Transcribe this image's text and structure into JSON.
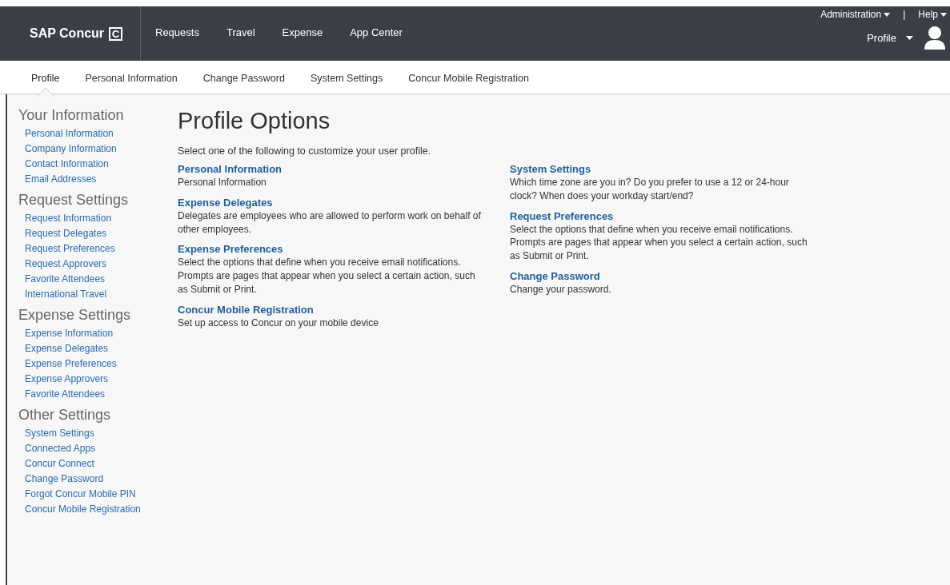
{
  "header": {
    "logo": "SAP Concur",
    "logo_mark": "C",
    "nav": [
      {
        "label": "Requests"
      },
      {
        "label": "Travel"
      },
      {
        "label": "Expense"
      },
      {
        "label": "App Center"
      }
    ],
    "top_links": [
      {
        "label": "Administration"
      },
      {
        "label": "Help"
      }
    ],
    "separator": "|",
    "profile_menu": "Profile"
  },
  "tabs": [
    {
      "label": "Profile",
      "selected": true
    },
    {
      "label": "Personal Information",
      "selected": false
    },
    {
      "label": "Change Password",
      "selected": false
    },
    {
      "label": "System Settings",
      "selected": false
    },
    {
      "label": "Concur Mobile Registration",
      "selected": false
    }
  ],
  "sidebar": [
    {
      "title": "Your Information",
      "items": [
        "Personal Information",
        "Company Information",
        "Contact Information",
        "Email Addresses"
      ]
    },
    {
      "title": "Request Settings",
      "items": [
        "Request Information",
        "Request Delegates",
        "Request Preferences",
        "Request Approvers",
        "Favorite Attendees",
        "International Travel"
      ]
    },
    {
      "title": "Expense Settings",
      "items": [
        "Expense Information",
        "Expense Delegates",
        "Expense Preferences",
        "Expense Approvers",
        "Favorite Attendees"
      ]
    },
    {
      "title": "Other Settings",
      "items": [
        "System Settings",
        "Connected Apps",
        "Concur Connect",
        "Change Password",
        "Forgot Concur Mobile PIN",
        "Concur Mobile Registration"
      ]
    }
  ],
  "main": {
    "title": "Profile Options",
    "intro": "Select one of the following to customize your user profile.",
    "columns": [
      [
        {
          "title": "Personal Information",
          "description": "Personal Information"
        },
        {
          "title": "Expense Delegates",
          "description": "Delegates are employees who are allowed to perform work on behalf of other employees."
        },
        {
          "title": "Expense Preferences",
          "description": "Select the options that define when you receive email notifications. Prompts are pages that appear when you select a certain action, such as Submit or Print."
        },
        {
          "title": "Concur Mobile Registration",
          "description": "Set up access to Concur on your mobile device"
        }
      ],
      [
        {
          "title": "System Settings",
          "description": "Which time zone are you in? Do you prefer to use a 12 or 24-hour clock? When does your workday start/end?"
        },
        {
          "title": "Request Preferences",
          "description": "Select the options that define when you receive email notifications. Prompts are pages that appear when you select a certain action, such as Submit or Print."
        },
        {
          "title": "Change Password",
          "description": "Change your password."
        }
      ]
    ]
  }
}
